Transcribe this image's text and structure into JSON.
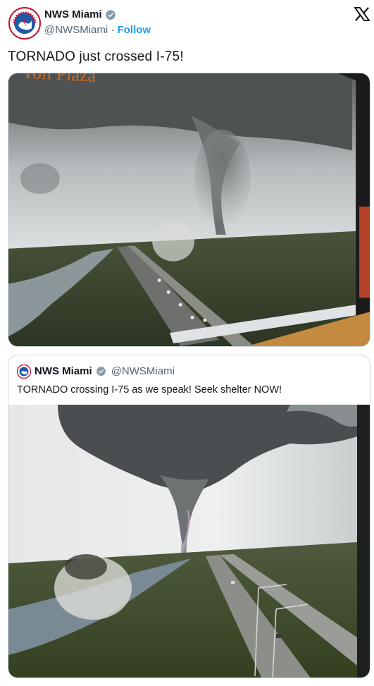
{
  "author": {
    "name": "NWS Miami",
    "handle": "@NWSMiami",
    "separator": " · ",
    "follow_label": "Follow",
    "avatar_icon": "nws-seal-icon",
    "avatar_text": "NATIONAL WEATHER SERVICE"
  },
  "tweet": {
    "text": "TORNADO just crossed I-75!",
    "media_overlay_text": "Toll Plaza"
  },
  "quoted": {
    "name": "NWS Miami",
    "handle": "@NWSMiami",
    "text": "TORNADO crossing I-75 as we speak! Seek shelter NOW!"
  },
  "icons": {
    "platform": "x-logo-icon",
    "verified": "verified-badge-icon"
  },
  "colors": {
    "link": "#1d9bf0",
    "secondary_text": "#536471",
    "border": "#cfd9de",
    "overlay_text": "#d2691e"
  }
}
